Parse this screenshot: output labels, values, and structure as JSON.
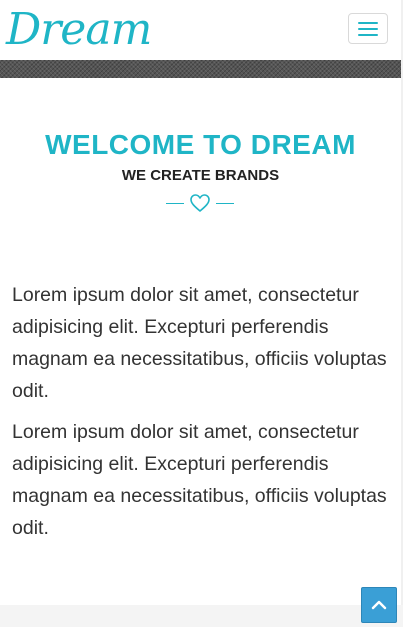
{
  "navbar": {
    "logo_text": "Dream",
    "menu_icon": "hamburger-icon"
  },
  "hero": {
    "title": "WELCOME TO DREAM",
    "subtitle": "WE CREATE BRANDS",
    "divider_icon": "heart-icon"
  },
  "content": {
    "paragraphs": [
      "Lorem ipsum dolor sit amet, consectetur adipisicing elit. Excepturi perferendis magnam ea necessitatibus, officiis voluptas odit.",
      "Lorem ipsum dolor sit amet, consectetur adipisicing elit. Excepturi perferendis magnam ea necessitatibus, officiis voluptas odit."
    ]
  },
  "back_to_top": {
    "icon": "chevron-up-icon"
  },
  "colors": {
    "accent": "#1fb5c6",
    "back_to_top_bg": "#3a9fd6",
    "text": "#333333"
  }
}
